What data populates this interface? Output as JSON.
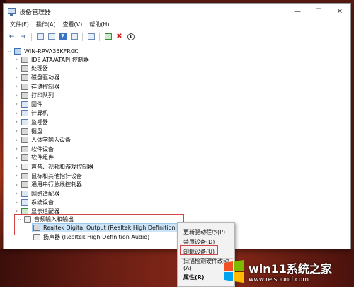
{
  "window": {
    "title": "设备管理器",
    "controls": {
      "minimize": "—",
      "maximize": "☐",
      "close": "✕"
    }
  },
  "menubar": [
    {
      "label": "文件(F)"
    },
    {
      "label": "操作(A)"
    },
    {
      "label": "查看(V)"
    },
    {
      "label": "帮助(H)"
    }
  ],
  "toolbar": {
    "back": "←",
    "forward": "→",
    "help": "?",
    "remove": "✖",
    "download": "⬇"
  },
  "tree": {
    "root": "WIN-RRVA35KFR0K",
    "categories": [
      {
        "label": "IDE ATA/ATAPI 控制器"
      },
      {
        "label": "处理器"
      },
      {
        "label": "磁盘驱动器"
      },
      {
        "label": "存储控制器"
      },
      {
        "label": "打印队列"
      },
      {
        "label": "固件"
      },
      {
        "label": "计算机"
      },
      {
        "label": "监视器"
      },
      {
        "label": "键盘"
      },
      {
        "label": "人体学输入设备"
      },
      {
        "label": "软件设备"
      },
      {
        "label": "软件组件"
      },
      {
        "label": "声音、视频和游戏控制器"
      },
      {
        "label": "鼠标和其他指针设备"
      },
      {
        "label": "通用串行总线控制器"
      },
      {
        "label": "网络适配器"
      },
      {
        "label": "系统设备"
      },
      {
        "label": "显示适配器"
      },
      {
        "label": "音频输入和输出"
      }
    ],
    "audio_children": [
      {
        "label": "Realtek Digital Output (Realtek High Definition Audio)"
      },
      {
        "label": "扬声器 (Realtek High Definition Audio)"
      }
    ]
  },
  "context_menu": [
    {
      "label": "更新驱动程序(P)"
    },
    {
      "label": "禁用设备(D)"
    },
    {
      "label": "卸载设备(U)"
    },
    {
      "label": "扫描检测硬件改动(A)"
    },
    {
      "label": "属性(R)"
    }
  ],
  "watermark": {
    "title": "win11系统之家",
    "url": "www.relsound.com"
  }
}
